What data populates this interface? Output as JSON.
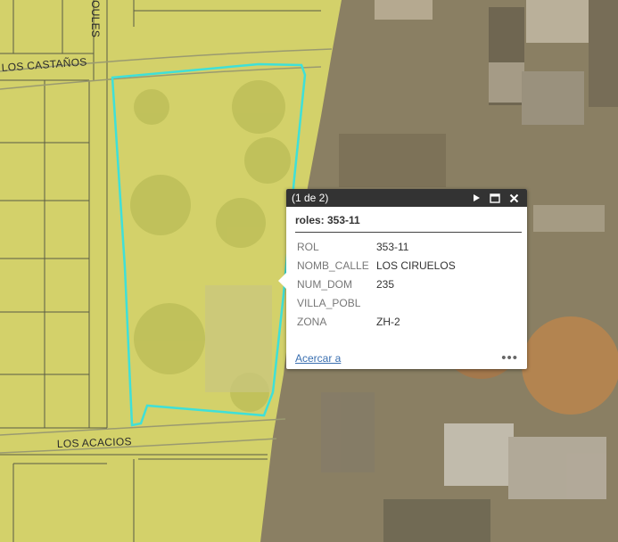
{
  "map": {
    "streets": [
      "LOS CASTAÑOS",
      "LOS ACACIOS",
      "OULES"
    ],
    "colors": {
      "zone_fill": "#d9d86a",
      "imagery": "#8a7f63",
      "selection_outline": "#3fe0d8",
      "parcel_line": "#555555"
    }
  },
  "popup": {
    "pager": "(1 de 2)",
    "title": "roles: 353-11",
    "attributes": [
      {
        "key": "ROL",
        "value": "353-11"
      },
      {
        "key": "NOMB_CALLE",
        "value": "LOS CIRUELOS"
      },
      {
        "key": "NUM_DOM",
        "value": "235"
      },
      {
        "key": "VILLA_POBL",
        "value": ""
      },
      {
        "key": "ZONA",
        "value": "ZH-2"
      }
    ],
    "zoom_link": "Acercar a",
    "icons": {
      "next": "play-next-icon",
      "maximize": "maximize-icon",
      "close": "close-icon",
      "more": "more-options-icon"
    }
  }
}
